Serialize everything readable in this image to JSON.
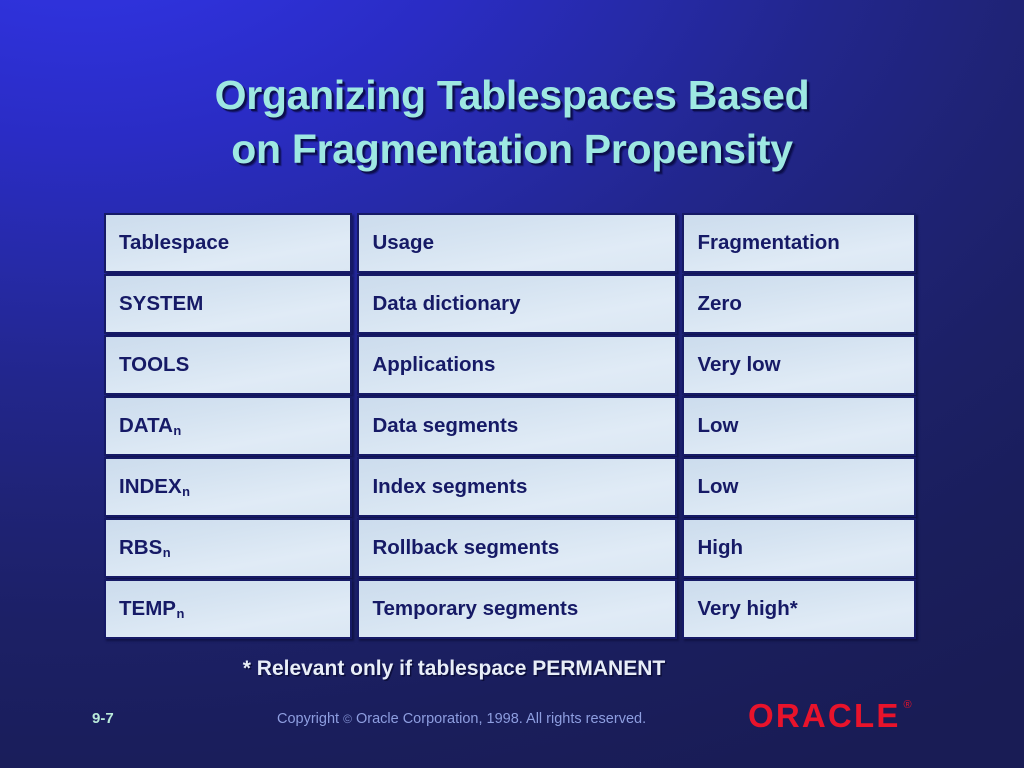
{
  "slide": {
    "title_line1": "Organizing Tablespaces Based",
    "title_line2": "on Fragmentation Propensity",
    "footnote": "* Relevant only if tablespace PERMANENT",
    "background_top_color": "#3438e6",
    "background_bottom_color": "#191c55",
    "title_color": "#9ee8e2"
  },
  "table": {
    "headers": {
      "tablespace": "Tablespace",
      "usage": "Usage",
      "fragmentation": "Fragmentation"
    },
    "cell_background": "#d7e4f2",
    "cell_text_color": "#161a66",
    "rows": [
      {
        "tablespace": "SYSTEM",
        "tablespace_sub": "",
        "usage": "Data dictionary",
        "fragmentation": "Zero"
      },
      {
        "tablespace": "TOOLS",
        "tablespace_sub": "",
        "usage": "Applications",
        "fragmentation": "Very low"
      },
      {
        "tablespace": "DATA",
        "tablespace_sub": "n",
        "usage": "Data segments",
        "fragmentation": "Low"
      },
      {
        "tablespace": "INDEX",
        "tablespace_sub": "n",
        "usage": "Index segments",
        "fragmentation": "Low"
      },
      {
        "tablespace": "RBS",
        "tablespace_sub": "n",
        "usage": "Rollback segments",
        "fragmentation": "High"
      },
      {
        "tablespace": "TEMP",
        "tablespace_sub": "n",
        "usage": "Temporary segments",
        "fragmentation": "Very high*"
      }
    ]
  },
  "footer": {
    "page_number": "9-7",
    "copyright_prefix": "Copyright",
    "copyright_symbol": "©",
    "copyright_suffix": "Oracle Corporation, 1998. All rights reserved.",
    "logo_text": "ORACLE",
    "logo_registered": "®",
    "logo_color": "#e8132b"
  }
}
